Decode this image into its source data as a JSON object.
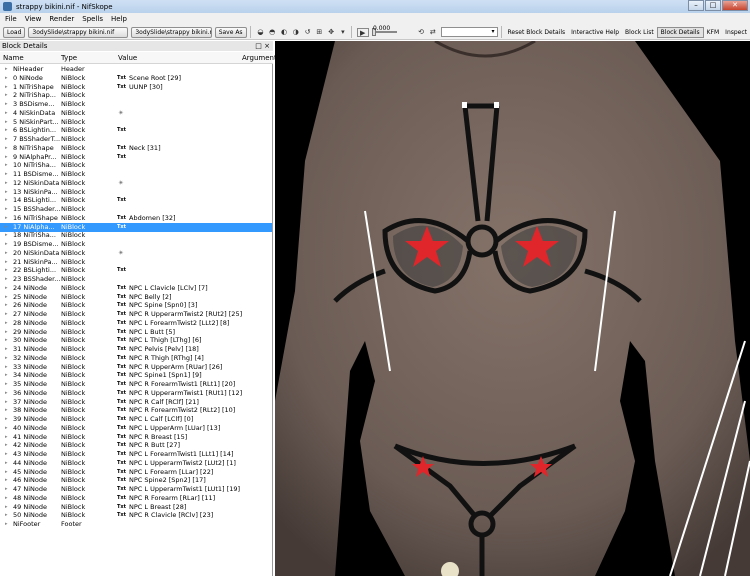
{
  "window": {
    "title": "strappy bikini.nif - NifSkope"
  },
  "menu": [
    "File",
    "View",
    "Render",
    "Spells",
    "Help"
  ],
  "toolbar": {
    "load_label": "Load",
    "load_path": "3odySlide\\strappy bikini.nif",
    "save_path": "3odySlide\\strappy bikini.nif",
    "save_as_label": "Save As",
    "time_value": "0.000",
    "reset_label": "Reset Block Details",
    "tabs": [
      "Interactive Help",
      "Block List",
      "Block Details",
      "KFM",
      "Inspect"
    ],
    "active_tab": "Block Details"
  },
  "panel": {
    "title": "Block Details",
    "controls": "□ ×"
  },
  "columns": [
    "Name",
    "Type",
    "Value",
    "Argument"
  ],
  "rows": [
    {
      "name": "NiHeader",
      "type": "Header",
      "value": "",
      "txt": "",
      "icon": "",
      "arrow": "▸"
    },
    {
      "name": "0 NiNode",
      "type": "NiBlock",
      "value": "Scene Root [29]",
      "txt": "Txt",
      "icon": "",
      "arrow": "▸"
    },
    {
      "name": "1 NiTriShape",
      "type": "NiBlock",
      "value": "UUNP [30]",
      "txt": "Txt",
      "icon": "",
      "arrow": "▸"
    },
    {
      "name": "2 NiTriShap...",
      "type": "NiBlock",
      "value": "",
      "txt": "",
      "icon": "",
      "arrow": "▸"
    },
    {
      "name": "3 BSDisme...",
      "type": "NiBlock",
      "value": "",
      "txt": "",
      "icon": "",
      "arrow": "▸"
    },
    {
      "name": "4 NiSkinData",
      "type": "NiBlock",
      "value": "",
      "txt": "",
      "icon": "✴",
      "arrow": "▸"
    },
    {
      "name": "5 NiSkinPart...",
      "type": "NiBlock",
      "value": "",
      "txt": "",
      "icon": "",
      "arrow": "▸"
    },
    {
      "name": "6 BSLightin...",
      "type": "NiBlock",
      "value": "",
      "txt": "Txt",
      "icon": "",
      "arrow": "▸"
    },
    {
      "name": "7 BSShaderT...",
      "type": "NiBlock",
      "value": "",
      "txt": "",
      "icon": "",
      "arrow": "▸"
    },
    {
      "name": "8 NiTriShape",
      "type": "NiBlock",
      "value": "Neck [31]",
      "txt": "Txt",
      "icon": "",
      "arrow": "▸"
    },
    {
      "name": "9 NiAlphaPr...",
      "type": "NiBlock",
      "value": "",
      "txt": "Txt",
      "icon": "",
      "arrow": "▸"
    },
    {
      "name": "10 NiTriSha...",
      "type": "NiBlock",
      "value": "",
      "txt": "",
      "icon": "",
      "arrow": "▸"
    },
    {
      "name": "11 BSDisme...",
      "type": "NiBlock",
      "value": "",
      "txt": "",
      "icon": "",
      "arrow": "▸"
    },
    {
      "name": "12 NiSkinData",
      "type": "NiBlock",
      "value": "",
      "txt": "",
      "icon": "✴",
      "arrow": "▸"
    },
    {
      "name": "13 NiSkinPa...",
      "type": "NiBlock",
      "value": "",
      "txt": "",
      "icon": "",
      "arrow": "▸"
    },
    {
      "name": "14 BSLighti...",
      "type": "NiBlock",
      "value": "",
      "txt": "Txt",
      "icon": "",
      "arrow": "▸"
    },
    {
      "name": "15 BSShader...",
      "type": "NiBlock",
      "value": "",
      "txt": "",
      "icon": "",
      "arrow": "▸"
    },
    {
      "name": "16 NiTriShape",
      "type": "NiBlock",
      "value": "Abdomen [32]",
      "txt": "Txt",
      "icon": "",
      "arrow": "▸"
    },
    {
      "name": "17 NiAlpha...",
      "type": "NiBlock",
      "value": "",
      "txt": "Txt",
      "icon": "",
      "arrow": "▸",
      "selected": true
    },
    {
      "name": "18 NiTriSha...",
      "type": "NiBlock",
      "value": "",
      "txt": "",
      "icon": "",
      "arrow": "▸"
    },
    {
      "name": "19 BSDisme...",
      "type": "NiBlock",
      "value": "",
      "txt": "",
      "icon": "",
      "arrow": "▸"
    },
    {
      "name": "20 NiSkinData",
      "type": "NiBlock",
      "value": "",
      "txt": "",
      "icon": "✴",
      "arrow": "▸"
    },
    {
      "name": "21 NiSkinPa...",
      "type": "NiBlock",
      "value": "",
      "txt": "",
      "icon": "",
      "arrow": "▸"
    },
    {
      "name": "22 BSLighti...",
      "type": "NiBlock",
      "value": "",
      "txt": "Txt",
      "icon": "",
      "arrow": "▸"
    },
    {
      "name": "23 BSShader...",
      "type": "NiBlock",
      "value": "",
      "txt": "",
      "icon": "",
      "arrow": "▸"
    },
    {
      "name": "24 NiNode",
      "type": "NiBlock",
      "value": "NPC L Clavicle [LClv] [7]",
      "txt": "Txt",
      "icon": "",
      "arrow": "▸"
    },
    {
      "name": "25 NiNode",
      "type": "NiBlock",
      "value": "NPC Belly [2]",
      "txt": "Txt",
      "icon": "",
      "arrow": "▸"
    },
    {
      "name": "26 NiNode",
      "type": "NiBlock",
      "value": "NPC Spine [Spn0] [3]",
      "txt": "Txt",
      "icon": "",
      "arrow": "▸"
    },
    {
      "name": "27 NiNode",
      "type": "NiBlock",
      "value": "NPC R UpperarmTwist2 [RUt2] [25]",
      "txt": "Txt",
      "icon": "",
      "arrow": "▸"
    },
    {
      "name": "28 NiNode",
      "type": "NiBlock",
      "value": "NPC L ForearmTwist2 [LLt2] [8]",
      "txt": "Txt",
      "icon": "",
      "arrow": "▸"
    },
    {
      "name": "29 NiNode",
      "type": "NiBlock",
      "value": "NPC L Butt [5]",
      "txt": "Txt",
      "icon": "",
      "arrow": "▸"
    },
    {
      "name": "30 NiNode",
      "type": "NiBlock",
      "value": "NPC L Thigh [LThg] [6]",
      "txt": "Txt",
      "icon": "",
      "arrow": "▸"
    },
    {
      "name": "31 NiNode",
      "type": "NiBlock",
      "value": "NPC Pelvis [Pelv] [18]",
      "txt": "Txt",
      "icon": "",
      "arrow": "▸"
    },
    {
      "name": "32 NiNode",
      "type": "NiBlock",
      "value": "NPC R Thigh [RThg] [4]",
      "txt": "Txt",
      "icon": "",
      "arrow": "▸"
    },
    {
      "name": "33 NiNode",
      "type": "NiBlock",
      "value": "NPC R UpperArm [RUar] [26]",
      "txt": "Txt",
      "icon": "",
      "arrow": "▸"
    },
    {
      "name": "34 NiNode",
      "type": "NiBlock",
      "value": "NPC Spine1 [Spn1] [9]",
      "txt": "Txt",
      "icon": "",
      "arrow": "▸"
    },
    {
      "name": "35 NiNode",
      "type": "NiBlock",
      "value": "NPC R ForearmTwist1 [RLt1] [20]",
      "txt": "Txt",
      "icon": "",
      "arrow": "▸"
    },
    {
      "name": "36 NiNode",
      "type": "NiBlock",
      "value": "NPC R UpperarmTwist1 [RUt1] [12]",
      "txt": "Txt",
      "icon": "",
      "arrow": "▸"
    },
    {
      "name": "37 NiNode",
      "type": "NiBlock",
      "value": "NPC R Calf [RClf] [21]",
      "txt": "Txt",
      "icon": "",
      "arrow": "▸"
    },
    {
      "name": "38 NiNode",
      "type": "NiBlock",
      "value": "NPC R ForearmTwist2 [RLt2] [10]",
      "txt": "Txt",
      "icon": "",
      "arrow": "▸"
    },
    {
      "name": "39 NiNode",
      "type": "NiBlock",
      "value": "NPC L Calf [LClf] [0]",
      "txt": "Txt",
      "icon": "",
      "arrow": "▸"
    },
    {
      "name": "40 NiNode",
      "type": "NiBlock",
      "value": "NPC L UpperArm [LUar] [13]",
      "txt": "Txt",
      "icon": "",
      "arrow": "▸"
    },
    {
      "name": "41 NiNode",
      "type": "NiBlock",
      "value": "NPC R Breast [15]",
      "txt": "Txt",
      "icon": "",
      "arrow": "▸"
    },
    {
      "name": "42 NiNode",
      "type": "NiBlock",
      "value": "NPC R Butt [27]",
      "txt": "Txt",
      "icon": "",
      "arrow": "▸"
    },
    {
      "name": "43 NiNode",
      "type": "NiBlock",
      "value": "NPC L ForearmTwist1 [LLt1] [14]",
      "txt": "Txt",
      "icon": "",
      "arrow": "▸"
    },
    {
      "name": "44 NiNode",
      "type": "NiBlock",
      "value": "NPC L UpperarmTwist2 [LUt2] [1]",
      "txt": "Txt",
      "icon": "",
      "arrow": "▸"
    },
    {
      "name": "45 NiNode",
      "type": "NiBlock",
      "value": "NPC L Forearm [LLar] [22]",
      "txt": "Txt",
      "icon": "",
      "arrow": "▸"
    },
    {
      "name": "46 NiNode",
      "type": "NiBlock",
      "value": "NPC Spine2 [Spn2] [17]",
      "txt": "Txt",
      "icon": "",
      "arrow": "▸"
    },
    {
      "name": "47 NiNode",
      "type": "NiBlock",
      "value": "NPC L UpperarmTwist1 [LUt1] [19]",
      "txt": "Txt",
      "icon": "",
      "arrow": "▸"
    },
    {
      "name": "48 NiNode",
      "type": "NiBlock",
      "value": "NPC R Forearm [RLar] [11]",
      "txt": "Txt",
      "icon": "",
      "arrow": "▸"
    },
    {
      "name": "49 NiNode",
      "type": "NiBlock",
      "value": "NPC L Breast [28]",
      "txt": "Txt",
      "icon": "",
      "arrow": "▸"
    },
    {
      "name": "50 NiNode",
      "type": "NiBlock",
      "value": "NPC R Clavicle [RClv] [23]",
      "txt": "Txt",
      "icon": "",
      "arrow": "▸"
    },
    {
      "name": "NiFooter",
      "type": "Footer",
      "value": "",
      "txt": "",
      "icon": "",
      "arrow": "▸"
    }
  ],
  "colors": {
    "selection": "#3399ff",
    "viewport_bg": "#000000",
    "skin": "#6e5e57",
    "accent_red": "#e0262a"
  }
}
